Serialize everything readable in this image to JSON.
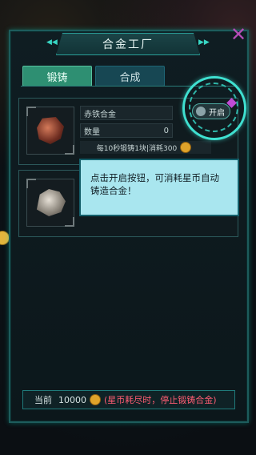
{
  "title": "合金工厂",
  "tabs": [
    {
      "label": "锻铸",
      "active": true
    },
    {
      "label": "合成",
      "active": false
    }
  ],
  "items": [
    {
      "name": "赤铁合金",
      "quantity_label": "数量",
      "quantity": "0",
      "info": "每10秒锻铸1块|消耗300"
    },
    {
      "name": "",
      "quantity_label": "",
      "quantity": ""
    }
  ],
  "open_button": {
    "label": "开启"
  },
  "tooltip": {
    "text": "点击开启按钮，可消耗星币自动铸造合金！"
  },
  "footer": {
    "current_label": "当前",
    "amount": "10000",
    "warning": "(星币耗尽时，停止锻铸合金)"
  },
  "icons": [
    "close-icon",
    "coin-icon",
    "gem-icon",
    "toggle-icon"
  ],
  "colors": {
    "accent": "#3fe0d0",
    "active_tab": "#2e8f72",
    "warning": "#ff5d73"
  }
}
